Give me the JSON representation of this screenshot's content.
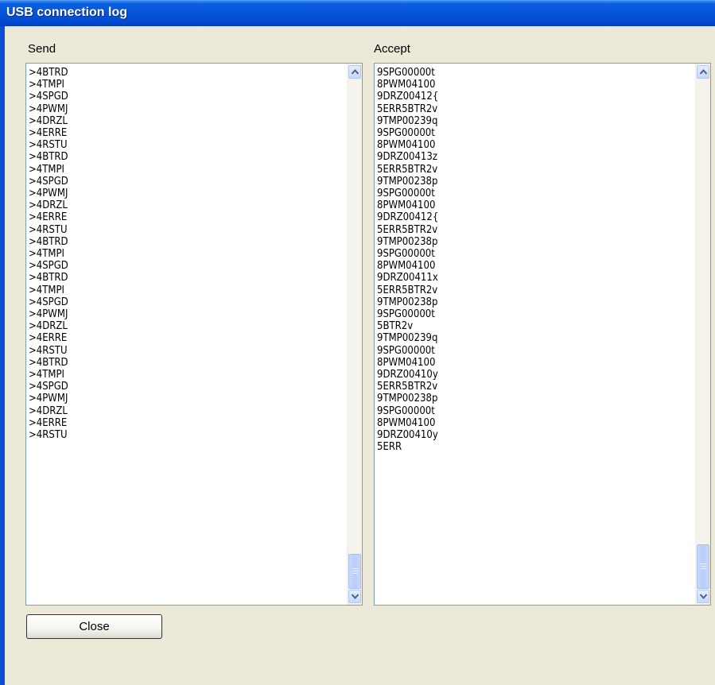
{
  "window": {
    "title": "USB connection log"
  },
  "send": {
    "label": "Send",
    "items": [
      ">4BTRD",
      ">4TMPI",
      ">4SPGD",
      ">4PWMJ",
      ">4DRZL",
      ">4ERRE",
      ">4RSTU",
      ">4BTRD",
      ">4TMPI",
      ">4SPGD",
      ">4PWMJ",
      ">4DRZL",
      ">4ERRE",
      ">4RSTU",
      ">4BTRD",
      ">4TMPI",
      ">4SPGD",
      ">4BTRD",
      ">4TMPI",
      ">4SPGD",
      ">4PWMJ",
      ">4DRZL",
      ">4ERRE",
      ">4RSTU",
      ">4BTRD",
      ">4TMPI",
      ">4SPGD",
      ">4PWMJ",
      ">4DRZL",
      ">4ERRE",
      ">4RSTU"
    ]
  },
  "accept": {
    "label": "Accept",
    "items": [
      "9SPG00000t",
      "8PWM04100",
      "9DRZ00412{",
      "5ERR5BTR2v",
      "9TMP00239q",
      "9SPG00000t",
      "8PWM04100",
      "9DRZ00413z",
      "5ERR5BTR2v",
      "9TMP00238p",
      "9SPG00000t",
      "8PWM04100",
      "9DRZ00412{",
      "5ERR5BTR2v",
      "9TMP00238p",
      "9SPG00000t",
      "8PWM04100",
      "9DRZ00411x",
      "5ERR5BTR2v",
      "9TMP00238p",
      "9SPG00000t",
      "5BTR2v",
      "9TMP00239q",
      "9SPG00000t",
      "8PWM04100",
      "9DRZ00410y",
      "5ERR5BTR2v",
      "9TMP00238p",
      "9SPG00000t",
      "8PWM04100",
      "9DRZ00410y",
      "5ERR"
    ]
  },
  "buttons": {
    "close_label": "Close"
  },
  "icons": {
    "scroll_up": "chevron-up-icon",
    "scroll_down": "chevron-down-icon"
  }
}
